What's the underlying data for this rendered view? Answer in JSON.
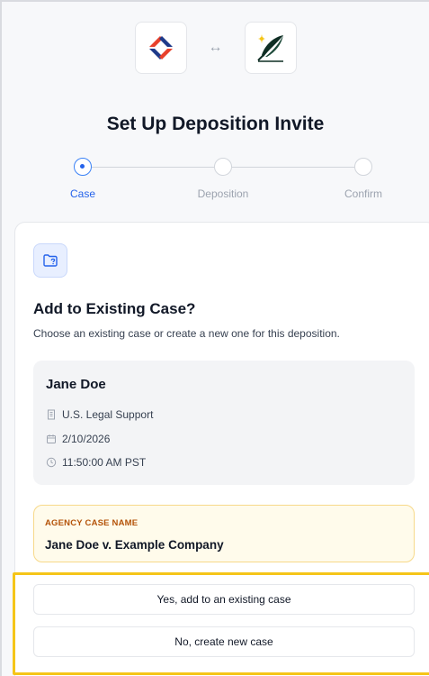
{
  "header": {
    "title": "Set Up Deposition Invite",
    "swap_icon": "↔"
  },
  "stepper": {
    "steps": [
      {
        "label": "Case",
        "active": true
      },
      {
        "label": "Deposition",
        "active": false
      },
      {
        "label": "Confirm",
        "active": false
      }
    ]
  },
  "case_prompt": {
    "heading": "Add to Existing Case?",
    "description": "Choose an existing case or create a new one for this deposition."
  },
  "details": {
    "name": "Jane Doe",
    "organization": "U.S. Legal Support",
    "date": "2/10/2026",
    "time": "11:50:00 AM PST"
  },
  "agency": {
    "label": "AGENCY CASE NAME",
    "value": "Jane Doe v. Example Company"
  },
  "actions": {
    "yes_label": "Yes, add to an existing case",
    "no_label": "No, create new case"
  },
  "colors": {
    "accent": "#2563eb",
    "highlight": "#f5c518",
    "agency_bg": "#fffbeb",
    "agency_label": "#b45309"
  }
}
